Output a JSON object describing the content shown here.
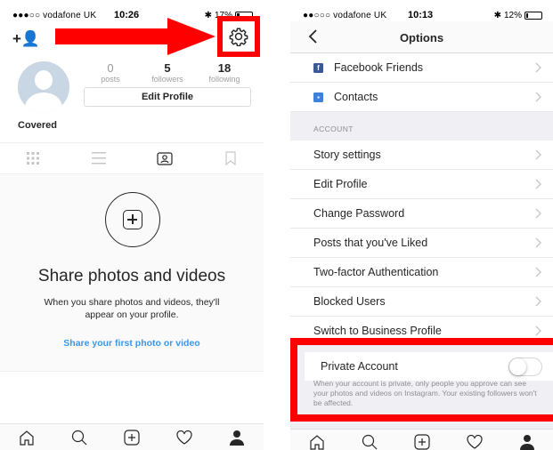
{
  "left": {
    "status": {
      "carrier": "●●●○○ vodafone UK",
      "time": "10:26",
      "battery": "17%"
    },
    "profile": {
      "username": "Covered",
      "edit_profile_label": "Edit Profile",
      "stats": [
        {
          "value": "0",
          "label": "posts"
        },
        {
          "value": "5",
          "label": "followers"
        },
        {
          "value": "18",
          "label": "following"
        }
      ]
    },
    "empty_state": {
      "title": "Share photos and videos",
      "description": "When you share photos and videos, they'll appear on your profile.",
      "link": "Share your first photo or video"
    },
    "annotation_color": "#ff0000"
  },
  "right": {
    "status": {
      "carrier": "●●○○○ vodafone UK",
      "time": "10:13",
      "battery": "12%"
    },
    "nav": {
      "title": "Options"
    },
    "top_rows": [
      {
        "label": "Facebook Friends",
        "icon": "facebook-icon",
        "color": "#3b5998"
      },
      {
        "label": "Contacts",
        "icon": "contacts-icon",
        "color": "#3f80d8"
      }
    ],
    "account_section": {
      "header": "ACCOUNT",
      "rows": [
        "Story settings",
        "Edit Profile",
        "Change Password",
        "Posts that you've Liked",
        "Two-factor Authentication",
        "Blocked Users",
        "Switch to Business Profile"
      ]
    },
    "private_account": {
      "label": "Private Account",
      "enabled": false,
      "description": "When your account is private, only people you approve can see your photos and videos on Instagram. Your existing followers won't be affected."
    }
  }
}
